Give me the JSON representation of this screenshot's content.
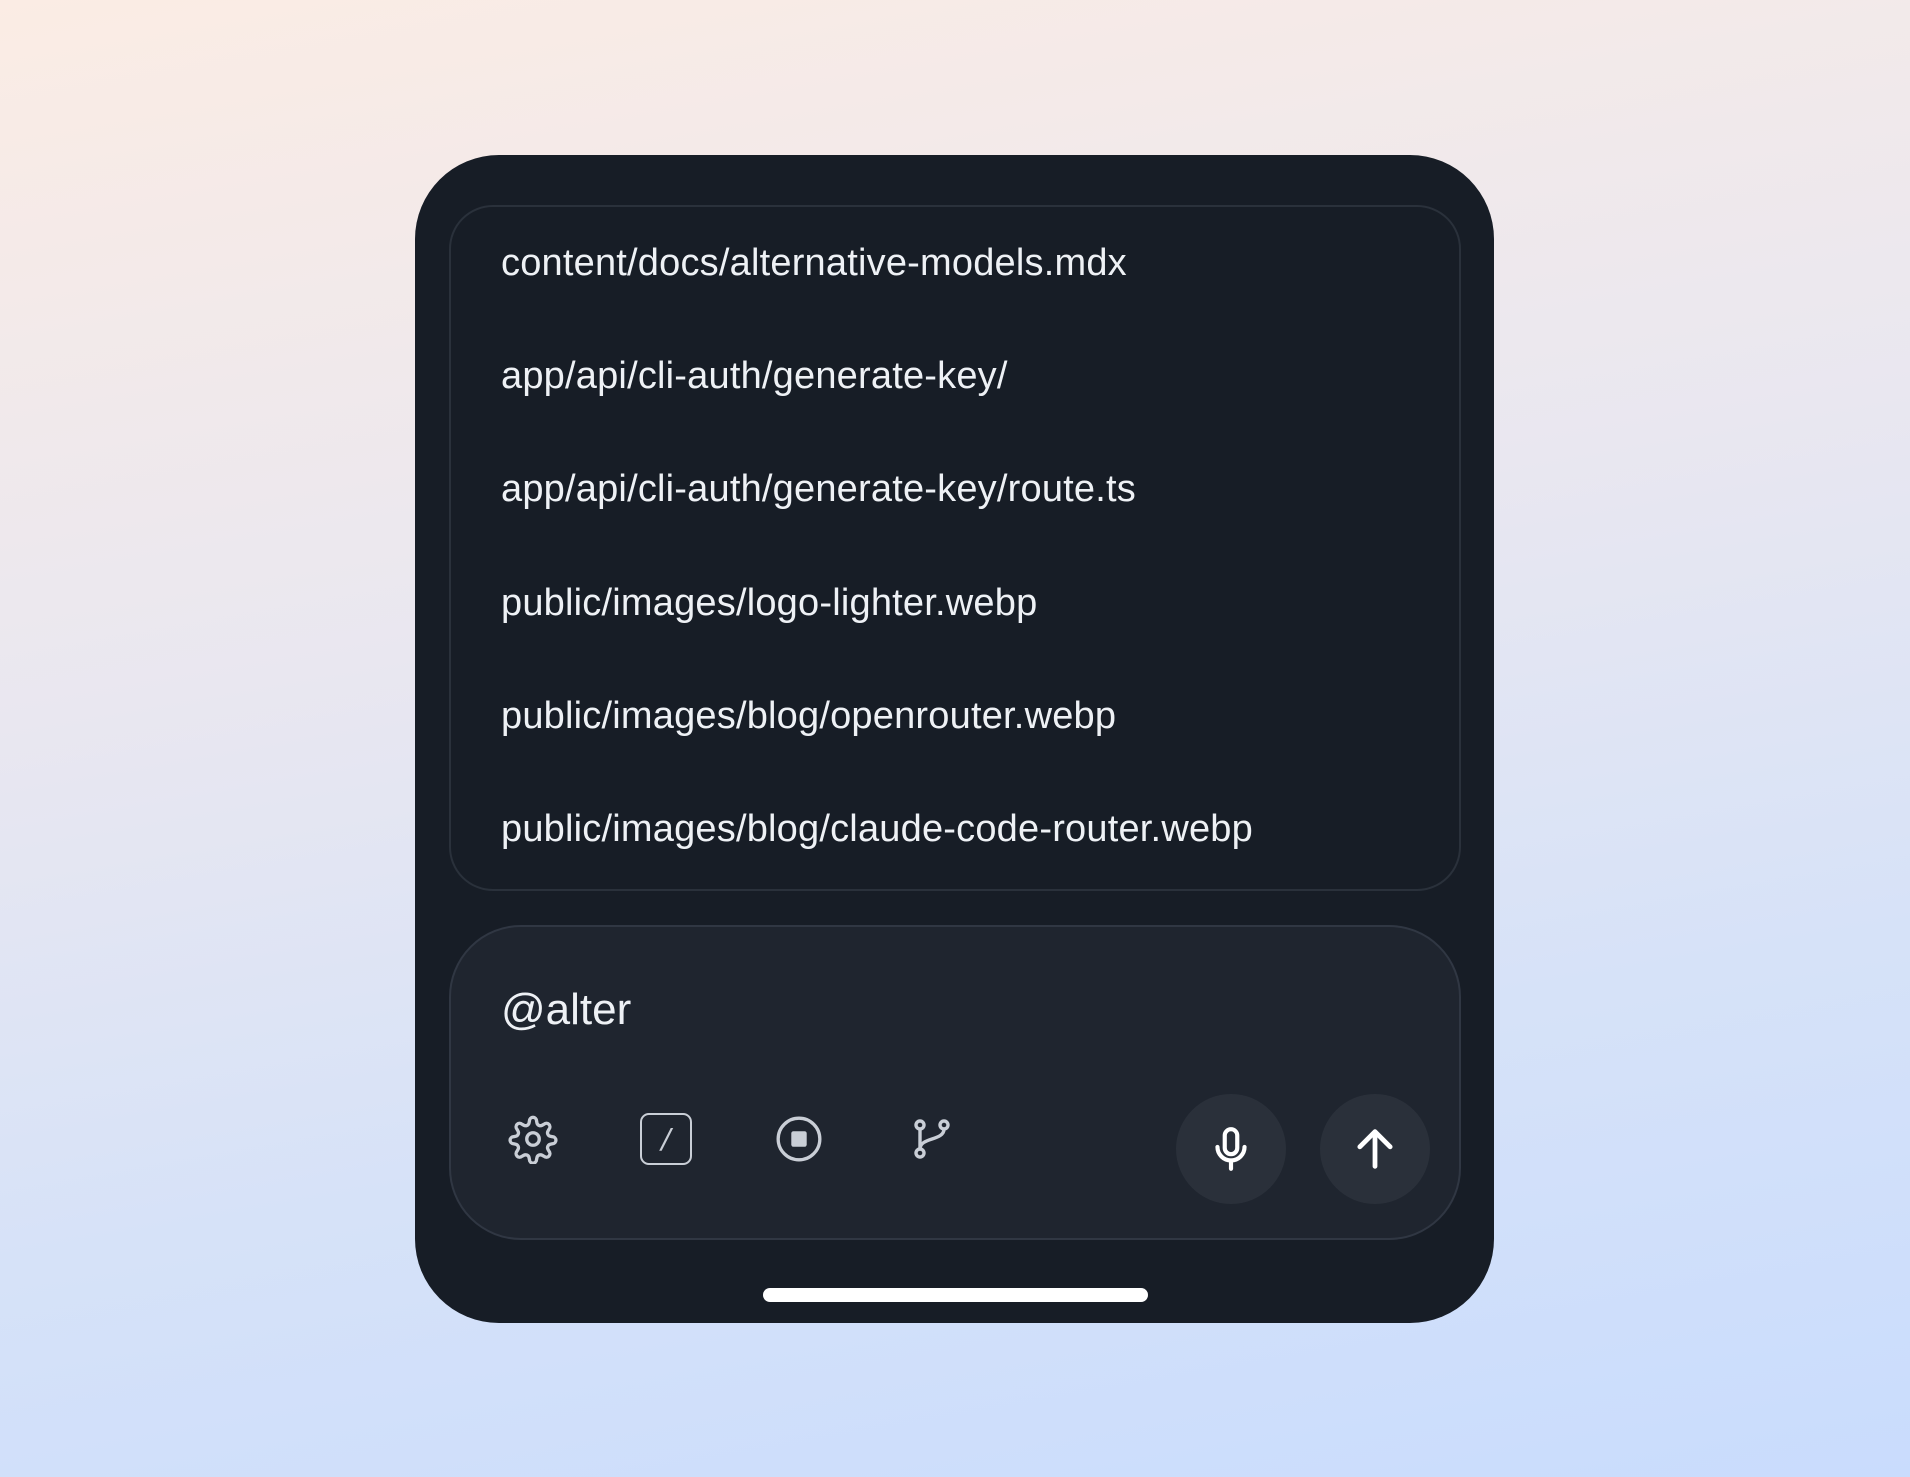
{
  "suggestions": [
    {
      "path": "content/docs/alternative-models.mdx"
    },
    {
      "path": "app/api/cli-auth/generate-key/"
    },
    {
      "path": "app/api/cli-auth/generate-key/route.ts"
    },
    {
      "path": "public/images/logo-lighter.webp"
    },
    {
      "path": "public/images/blog/openrouter.webp"
    },
    {
      "path": "public/images/blog/claude-code-router.webp"
    }
  ],
  "composer": {
    "value": "@alter"
  },
  "toolbar": {
    "commands_glyph": "/",
    "icons": [
      "gear-icon",
      "slash-command-icon",
      "stop-circle-icon",
      "git-branch-icon",
      "microphone-icon",
      "arrow-up-icon"
    ]
  },
  "colors": {
    "panel": "#171d26",
    "composer": "#1f252f",
    "text": "#eef1f5",
    "icon": "#c9ced6"
  }
}
